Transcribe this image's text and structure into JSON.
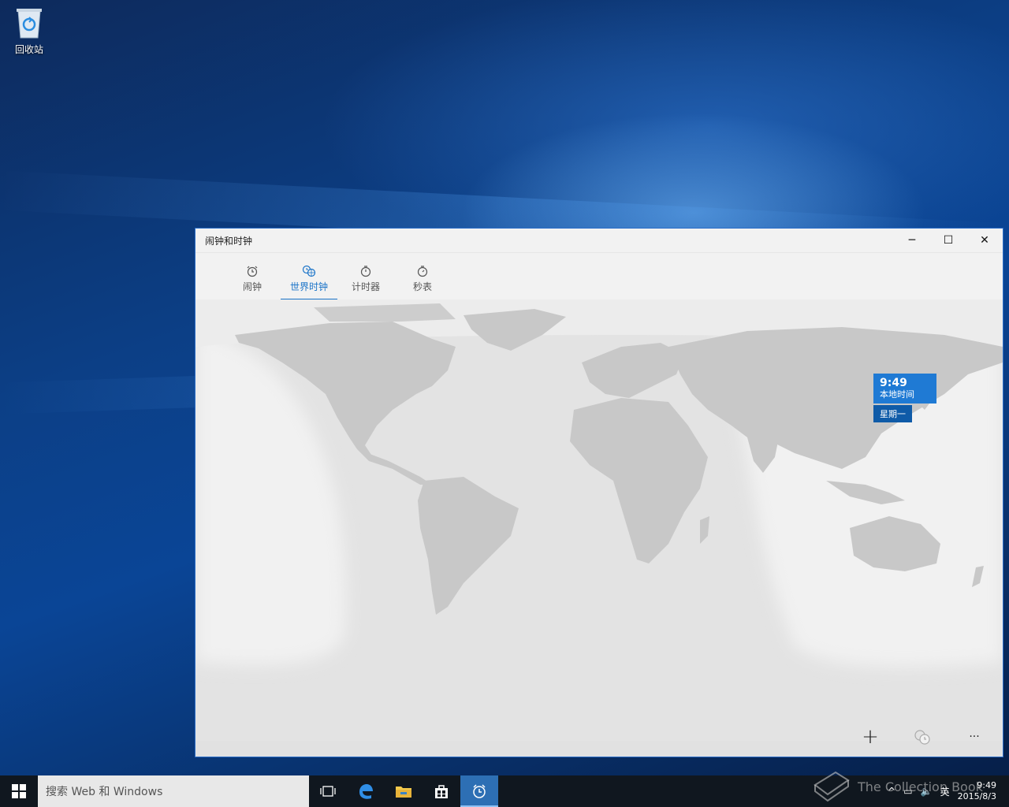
{
  "desktop": {
    "recycle_bin_label": "回收站"
  },
  "window": {
    "title": "闹钟和时钟",
    "controls": {
      "minimize": "─",
      "maximize": "☐",
      "close": "✕"
    },
    "tabs": [
      {
        "label": "闹钟",
        "icon": "alarm-clock-icon"
      },
      {
        "label": "世界时钟",
        "icon": "world-clock-icon",
        "active": true
      },
      {
        "label": "计时器",
        "icon": "timer-icon"
      },
      {
        "label": "秒表",
        "icon": "stopwatch-icon"
      }
    ],
    "local_tag": {
      "time": "9:49",
      "label": "本地时间",
      "day": "星期一"
    },
    "bottom": {
      "add": "+",
      "more": "···"
    }
  },
  "taskbar": {
    "search_placeholder": "搜索 Web 和 Windows",
    "ime": "英",
    "tray_time": "9:49",
    "tray_date": "2015/8/3",
    "watermark": "The Collection Book"
  },
  "colors": {
    "accent": "#1a73c8",
    "tag_bg": "#1f7ad4",
    "taskbar": "#10171f",
    "land": "#c8c8c8"
  }
}
